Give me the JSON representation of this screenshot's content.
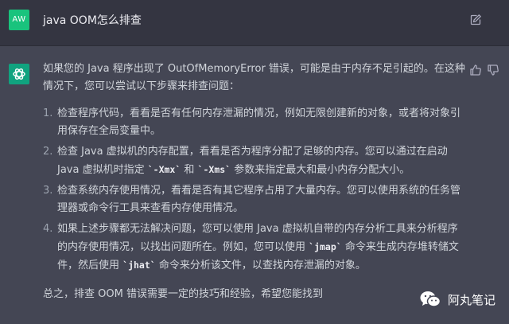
{
  "question": {
    "avatar_initials": "AW",
    "text": "java OOM怎么排查"
  },
  "answer": {
    "intro": "如果您的 Java 程序出现了 OutOfMemoryError 错误，可能是由于内存不足引起的。在这种情况下，您可以尝试以下步骤来排查问题：",
    "steps": [
      {
        "num": "1.",
        "parts": [
          "检查程序代码，看看是否有任何内存泄漏的情况，例如无限创建新的对象，或者将对象引用保存在全局变量中。"
        ]
      },
      {
        "num": "2.",
        "parts": [
          "检查 Java 虚拟机的内存配置，看看是否为程序分配了足够的内存。您可以通过在启动 Java 虚拟机时指定 ",
          "`-Xmx`",
          " 和 ",
          "`-Xms`",
          " 参数来指定最大和最小内存分配大小。"
        ]
      },
      {
        "num": "3.",
        "parts": [
          "检查系统内存使用情况，看看是否有其它程序占用了大量内存。您可以使用系统的任务管理器或命令行工具来查看内存使用情况。"
        ]
      },
      {
        "num": "4.",
        "parts": [
          "如果上述步骤都无法解决问题，您可以使用 Java 虚拟机自带的内存分析工具来分析程序的内存使用情况，以找出问题所在。例如，您可以使用 ",
          "`jmap`",
          " 命令来生成内存堆转储文件，然后使用 ",
          "`jhat`",
          " 命令来分析该文件，以查找内存泄漏的对象。"
        ]
      }
    ],
    "summary": "总之，排查 OOM 错误需要一定的技巧和经验，希望您能找到"
  },
  "watermark": {
    "text": "阿丸笔记"
  },
  "icons": {
    "edit": "edit-icon",
    "thumbs_up": "thumbs-up-icon",
    "thumbs_down": "thumbs-down-icon",
    "bot_logo": "openai-logo-icon",
    "wechat": "wechat-icon"
  },
  "colors": {
    "background": "#444654",
    "user_row": "#343541",
    "user_avatar": "#19c37d",
    "bot_avatar": "#10a37f",
    "text": "#d1d5db"
  }
}
